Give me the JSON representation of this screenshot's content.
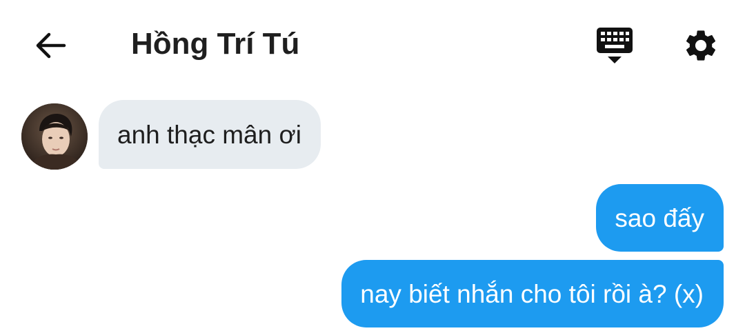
{
  "header": {
    "title": "Hồng Trí Tú",
    "back_icon": "arrow-left-icon",
    "keyboard_icon": "keyboard-hide-icon",
    "settings_icon": "gear-icon"
  },
  "messages": [
    {
      "direction": "incoming",
      "text": "anh thạc mân ơi"
    },
    {
      "direction": "outgoing",
      "text": "sao đấy"
    },
    {
      "direction": "outgoing",
      "text": "nay biết nhắn cho tôi rồi à? (x)"
    }
  ],
  "colors": {
    "outgoing_bubble": "#1d9bf0",
    "incoming_bubble": "#e7ecf0",
    "title_text": "#1f1f1f",
    "icon": "#111111"
  }
}
